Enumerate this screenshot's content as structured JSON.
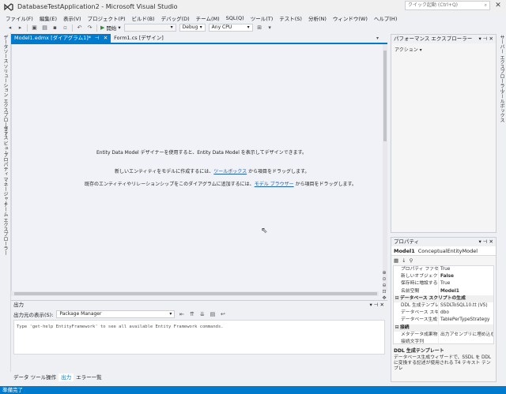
{
  "window": {
    "title": "DatabaseTestApplication2 - Microsoft Visual Studio",
    "controls": [
      "_",
      "□",
      "✕"
    ]
  },
  "menu": {
    "items": [
      "ファイル(F)",
      "編集(E)",
      "表示(V)",
      "プロジェクト(P)",
      "ビルド(B)",
      "デバッグ(D)",
      "チーム(M)",
      "SQL(Q)",
      "ツール(T)",
      "テスト(S)",
      "分析(N)",
      "ウィンドウ(W)",
      "ヘルプ(H)"
    ],
    "quick_launch_placeholder": "クイック起動 (Ctrl+Q)",
    "quick_launch_icon": "search-icon"
  },
  "toolbar": {
    "start_label": "開始",
    "config_value": "Debug",
    "platform_value": "Any CPU",
    "empty_combo_value": ""
  },
  "left_rail": {
    "tabs": [
      "データソース",
      "ソリューション エクスプローラー",
      "クラス ビュー",
      "プロパティ マネージャー",
      "チーム エクスプローラー"
    ]
  },
  "right_rail": {
    "tabs": [
      "サーバー エクスプローラー",
      "ツールボックス"
    ]
  },
  "documents": {
    "tabs": [
      {
        "label": "Model1.edmx [ダイアグラム1]*",
        "active": true
      },
      {
        "label": "Form1.cs [デザイン]",
        "active": false
      }
    ]
  },
  "designer": {
    "line1": "Entity Data Model デザイナーを使用すると、Entity Data Model を表示してデザインできます。",
    "line2_prefix": "新しいエンティティをモデルに作成するには、",
    "line2_link": "ツールボックス",
    "line2_suffix": " から項目をドラッグします。",
    "line3_prefix": "既存のエンティティやリレーションシップをこのダイアグラムに追加するには、",
    "line3_link": "モデル ブラウザー",
    "line3_suffix": " から項目をドラッグします。"
  },
  "output": {
    "title": "出力",
    "source_label": "出力元の表示(S):",
    "source_value": "Package Manager",
    "text": "Type 'get-help EntityFramework' to see all available Entity Framework commands.",
    "tabs": [
      "データ ツール操作",
      "出力",
      "エラー一覧"
    ],
    "active_tab": "出力"
  },
  "perf_panel": {
    "title": "パフォーマンス エクスプローラー",
    "action_label": "アクション"
  },
  "properties": {
    "title": "プロパティ",
    "object_name": "Model1",
    "object_type": "ConceptualEntityModel",
    "rows": [
      {
        "kind": "prop",
        "name": "プロパティ ファセット",
        "value": "True"
      },
      {
        "kind": "prop",
        "name": "新しいオブジェクトに",
        "value": "False"
      },
      {
        "kind": "prop",
        "name": "保存時に増設する",
        "value": "True"
      },
      {
        "kind": "prop",
        "name": "名前空間",
        "value": "Model1"
      },
      {
        "kind": "cat",
        "name": "データベース スクリプトの生成",
        "expander": "⊟"
      },
      {
        "kind": "prop",
        "name": "DDL 生成テンプレ",
        "value": "SSDLToSQL10.tt (VS)"
      },
      {
        "kind": "prop",
        "name": "データベース スキー",
        "value": "dbo"
      },
      {
        "kind": "prop",
        "name": "データベース生成ワ",
        "value": "TablePerTypeStrategy"
      },
      {
        "kind": "cat",
        "name": "接続",
        "expander": "⊟"
      },
      {
        "kind": "prop",
        "name": "メタデータ成果物の",
        "value": "出力アセンブリに埋め込む"
      },
      {
        "kind": "prop",
        "name": "接続文字列",
        "value": ""
      }
    ],
    "desc_title": "DDL 生成テンプレート",
    "desc_text": "データベース生成ウィザードで、SSDL を DDL に変換する記述が使用される T4 テキスト テンプレ"
  },
  "status": {
    "text": "準備完了"
  },
  "colors": {
    "accent": "#007acc",
    "link": "#1e5fb4"
  }
}
